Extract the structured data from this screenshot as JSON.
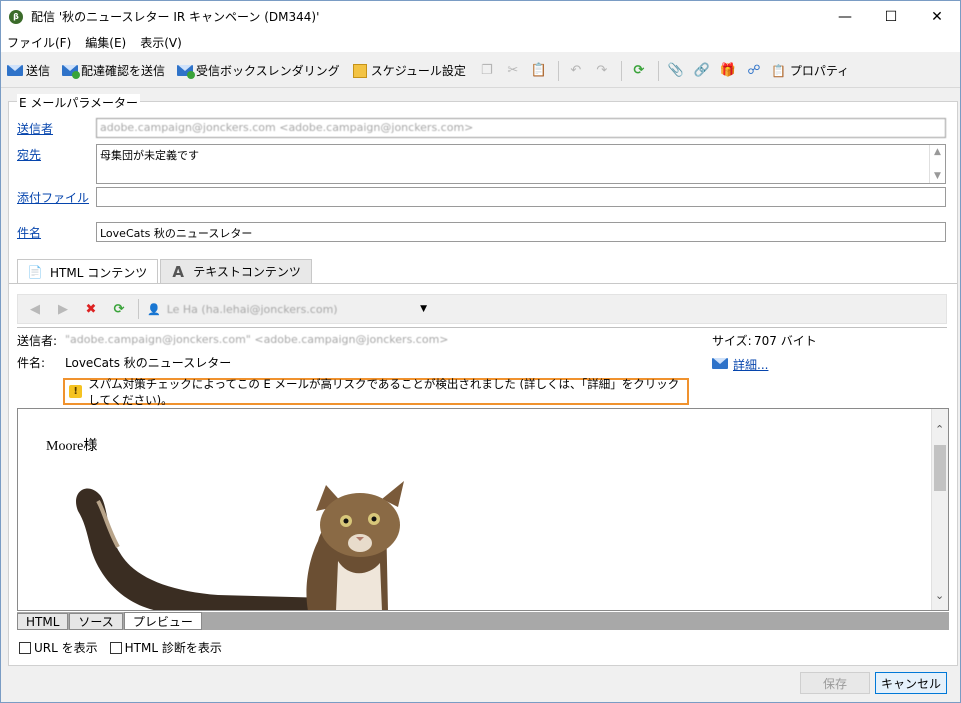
{
  "window": {
    "title": "配信 '秋のニュースレター IR キャンペーン (DM344)'",
    "app_icon": "campaign-logo-icon"
  },
  "menu": [
    "ファイル(F)",
    "編集(E)",
    "表示(V)"
  ],
  "toolbar": {
    "send": "送信",
    "send_proof": "配達確認を送信",
    "inbox_rendering": "受信ボックスレンダリング",
    "schedule": "スケジュール設定",
    "properties": "プロパティ"
  },
  "email_params": {
    "group_label": "E メールパラメーター",
    "sender_label": "送信者",
    "sender_value": "adobe.campaign@jonckers.com <adobe.campaign@jonckers.com>",
    "to_label": "宛先",
    "to_value": "母集団が未定義です",
    "attach_label": "添付ファイル",
    "attach_value": "",
    "subject_label": "件名",
    "subject_value": "LoveCats 秋のニュースレター"
  },
  "tabs": {
    "html": "HTML コンテンツ",
    "text": "テキストコンテンツ"
  },
  "preview_toolbar": {
    "user": "Le Ha (ha.lehai@jonckers.com)"
  },
  "info": {
    "sender_label": "送信者:",
    "sender_value": "\"adobe.campaign@jonckers.com\" <adobe.campaign@jonckers.com>",
    "subject_label": "件名:",
    "subject_value": "LoveCats 秋のニュースレター",
    "size_label": "サイズ:",
    "size_value": "707 バイト",
    "details_link": "詳細...",
    "warning": "スパム対策チェックによってこの E メールが高リスクであることが検出されました (詳しくは、「詳細」をクリックしてください)。"
  },
  "preview": {
    "greeting": "Moore様"
  },
  "bottom_tabs": [
    "HTML",
    "ソース",
    "プレビュー"
  ],
  "checkboxes": {
    "show_url": "URL を表示",
    "show_html_diag": "HTML 診断を表示"
  },
  "footer": {
    "save": "保存",
    "cancel": "キャンセル"
  },
  "colors": {
    "link": "#0645ad",
    "warning_border": "#f0922e",
    "accent_blue": "#2f73c9"
  }
}
